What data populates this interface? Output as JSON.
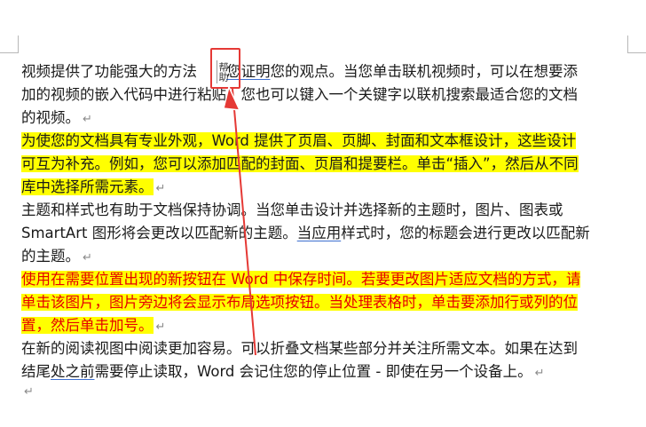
{
  "document": {
    "paragraphs": [
      {
        "style": "normal",
        "lines": [
          [
            "视频提供了功能强大的方法",
            "帮助",
            "您证明",
            "您的观点。当您单击联机视频时，可以在想要添"
          ],
          [
            "加的视频的嵌入代码中进行粘贴。您也可以键入一个关键字以联机搜索最适合您的文档"
          ],
          [
            "的视频。"
          ]
        ]
      },
      {
        "style": "highlight",
        "lines": [
          [
            "为使您的文档具有专业外观，Word 提供了页眉、页脚、封面和文本框设计，这些设计"
          ],
          [
            "可互为补充。例如，您可以添加匹配的封面、页眉和提要栏。单击“插入”，然后从不同"
          ],
          [
            "库中选择所需元素。"
          ]
        ]
      },
      {
        "style": "normal",
        "lines": [
          [
            "主题和样式也有助于文档保持协调。当您单击设计并选择新的主题时，图片、图表或"
          ],
          [
            "SmartArt 图形将会更改以匹配新的主题。",
            "当应用",
            "样式时，您的标题会进行更改以匹配新"
          ],
          [
            "的主题。"
          ]
        ]
      },
      {
        "style": "red-highlight",
        "lines": [
          [
            "使用在需要位置出现的新按钮在 Word 中保存时间。若要更改图片适应文档的方式，请"
          ],
          [
            "单击该图片，图片旁边将会显示布局选项按钮。当处理表格时，单击要添加行或列的位"
          ],
          [
            "置，然后单击加号。"
          ]
        ]
      },
      {
        "style": "normal",
        "lines": [
          [
            "在新的阅读视图中阅读更加容易。可以折叠文档某些部分并关注所需文本。如果在达到"
          ],
          [
            "结尾",
            "处之前",
            "需要停止读取，Word 会记住您的停止位置 - 即使在另一个设备上。"
          ]
        ]
      }
    ],
    "paragraph_mark": "↵",
    "vertical_textbox": {
      "text": "帮助"
    }
  },
  "colors": {
    "highlight": "#ffff00",
    "red_text": "#e60000",
    "annotation": "#e53935"
  }
}
